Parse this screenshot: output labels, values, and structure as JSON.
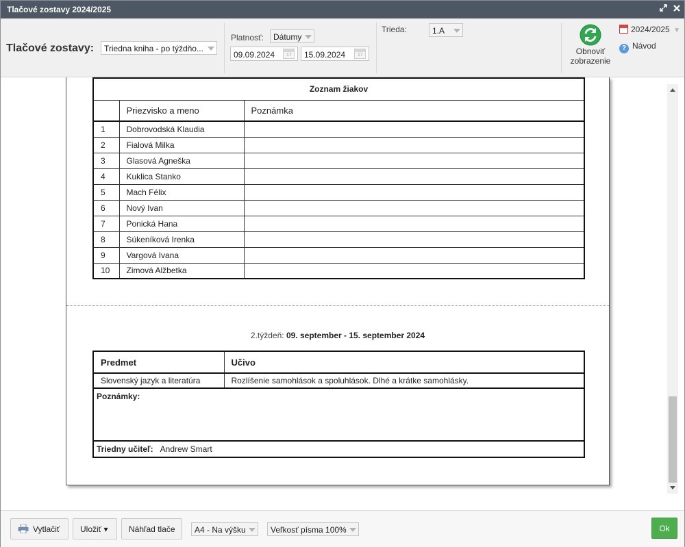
{
  "window": {
    "title": "Tlačové zostavy 2024/2025"
  },
  "toolbar": {
    "reports_label": "Tlačové zostavy:",
    "report_select": "Triedna kniha - po týždňo...",
    "validity_label": "Platnosť:",
    "validity_select": "Dátumy",
    "date_from": "09.09.2024",
    "date_to": "15.09.2024",
    "class_label": "Trieda:",
    "class_select": "1.A",
    "refresh_line1": "Obnoviť",
    "refresh_line2": "zobrazenie",
    "school_year": "2024/2025",
    "help": "Návod"
  },
  "students": {
    "caption": "Zoznam žiakov",
    "col_name": "Priezvisko a meno",
    "col_note": "Poznámka",
    "rows": [
      {
        "num": "1",
        "name": "Dobrovodská Klaudia"
      },
      {
        "num": "2",
        "name": "Fialová Milka"
      },
      {
        "num": "3",
        "name": "Glasová Agneška"
      },
      {
        "num": "4",
        "name": "Kuklica Stanko"
      },
      {
        "num": "5",
        "name": "Mach Félix"
      },
      {
        "num": "6",
        "name": "Nový Ivan"
      },
      {
        "num": "7",
        "name": "Ponická Hana"
      },
      {
        "num": "8",
        "name": "Súkeníková Irenka"
      },
      {
        "num": "9",
        "name": "Vargová Ivana"
      },
      {
        "num": "10",
        "name": "Zimová Alžbetka"
      }
    ]
  },
  "week": {
    "prefix": "2.týždeň: ",
    "range": "09. september - 15. september 2024"
  },
  "lessons": {
    "col_subject": "Predmet",
    "col_content": "Učivo",
    "subject": "Slovenský jazyk a literatúra",
    "content": "Rozlíšenie samohlások a spoluhlások. Dlhé a krátke samohlásky.",
    "notes_label": "Poznámky:",
    "teacher_label": "Triedny učiteľ:",
    "teacher_name": "Andrew Smart"
  },
  "bottom": {
    "print": "Vytlačiť",
    "save": "Uložiť ▾",
    "preview": "Náhľad tlače",
    "page_format": "A4 - Na výšku",
    "font_size": "Veľkosť písma 100%",
    "ok": "Ok"
  },
  "colors": {
    "titlebar": "#4d5864",
    "ok": "#4cae4c",
    "refresh": "#2fa84f"
  },
  "icons": [
    "expand-icon",
    "close-icon",
    "calendar-icon",
    "refresh-icon",
    "help-icon",
    "printer-icon"
  ]
}
